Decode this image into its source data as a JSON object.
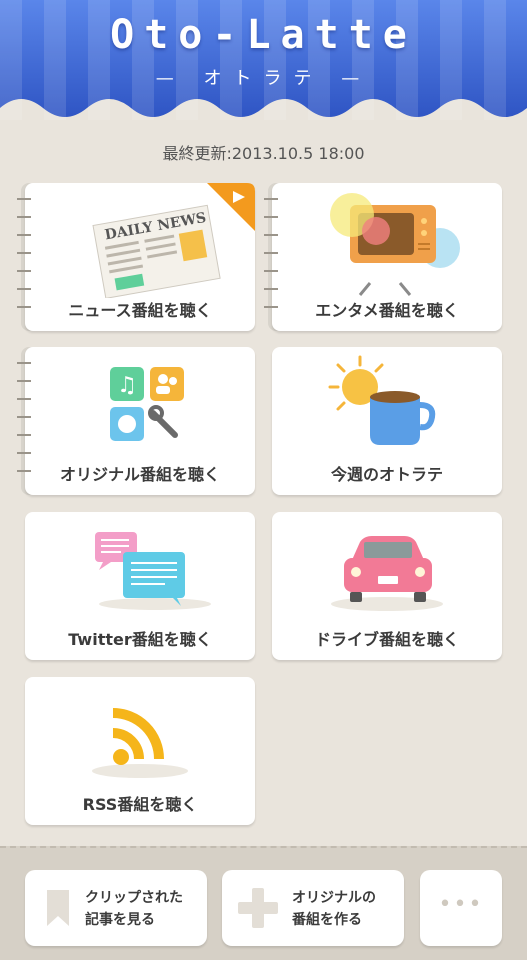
{
  "header": {
    "title": "Oto-Latte",
    "subtitle": "— オトラテ —"
  },
  "last_updated": "最終更新:2013.10.5 18:00",
  "cards": {
    "news": {
      "label": "ニュース番組を聴く",
      "art_text": "DAILY NEWS"
    },
    "entame": {
      "label": "エンタメ番組を聴く"
    },
    "original": {
      "label": "オリジナル番組を聴く"
    },
    "weekly": {
      "label": "今週のオトラテ"
    },
    "twitter": {
      "label": "Twitter番組を聴く"
    },
    "drive": {
      "label": "ドライブ番組を聴く"
    },
    "rss": {
      "label": "RSS番組を聴く"
    }
  },
  "bottom": {
    "clip": {
      "line1": "クリップされた",
      "line2": "記事を見る"
    },
    "create": {
      "line1": "オリジナルの",
      "line2": "番組を作る"
    },
    "more": {
      "label": "•••"
    }
  },
  "colors": {
    "header_blue": "#3d64d6",
    "accent_orange": "#f39a1e",
    "background": "#e9e4dc"
  }
}
